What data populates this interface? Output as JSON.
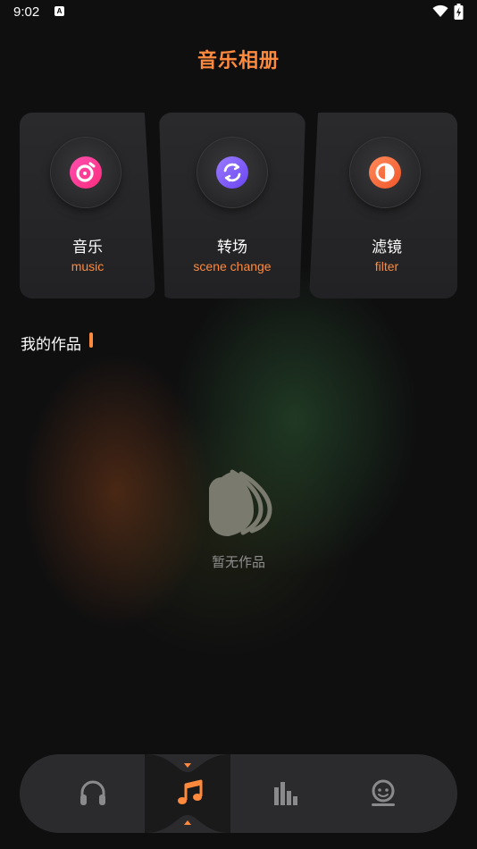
{
  "status_bar": {
    "time": "9:02",
    "notification_letter": "A"
  },
  "header": {
    "title": "音乐相册"
  },
  "features": [
    {
      "title": "音乐",
      "subtitle": "music",
      "icon": "music-disc-icon",
      "color": "#ff3d9a"
    },
    {
      "title": "转场",
      "subtitle": "scene change",
      "icon": "transition-icon",
      "color": "#7c5cff"
    },
    {
      "title": "滤镜",
      "subtitle": "filter",
      "icon": "filter-icon",
      "color": "#ff6a3d"
    }
  ],
  "works": {
    "title": "我的作品",
    "empty_text": "暂无作品"
  },
  "tabbar": {
    "active_color": "#ff8a3d",
    "inactive_color": "#8a8a8c",
    "tabs": [
      "headphones-icon",
      "music-note-icon",
      "equalizer-icon",
      "profile-icon"
    ],
    "active_index": 1
  },
  "colors": {
    "accent": "#ff8a3d",
    "background": "#0f0f10",
    "card": "#262628"
  }
}
